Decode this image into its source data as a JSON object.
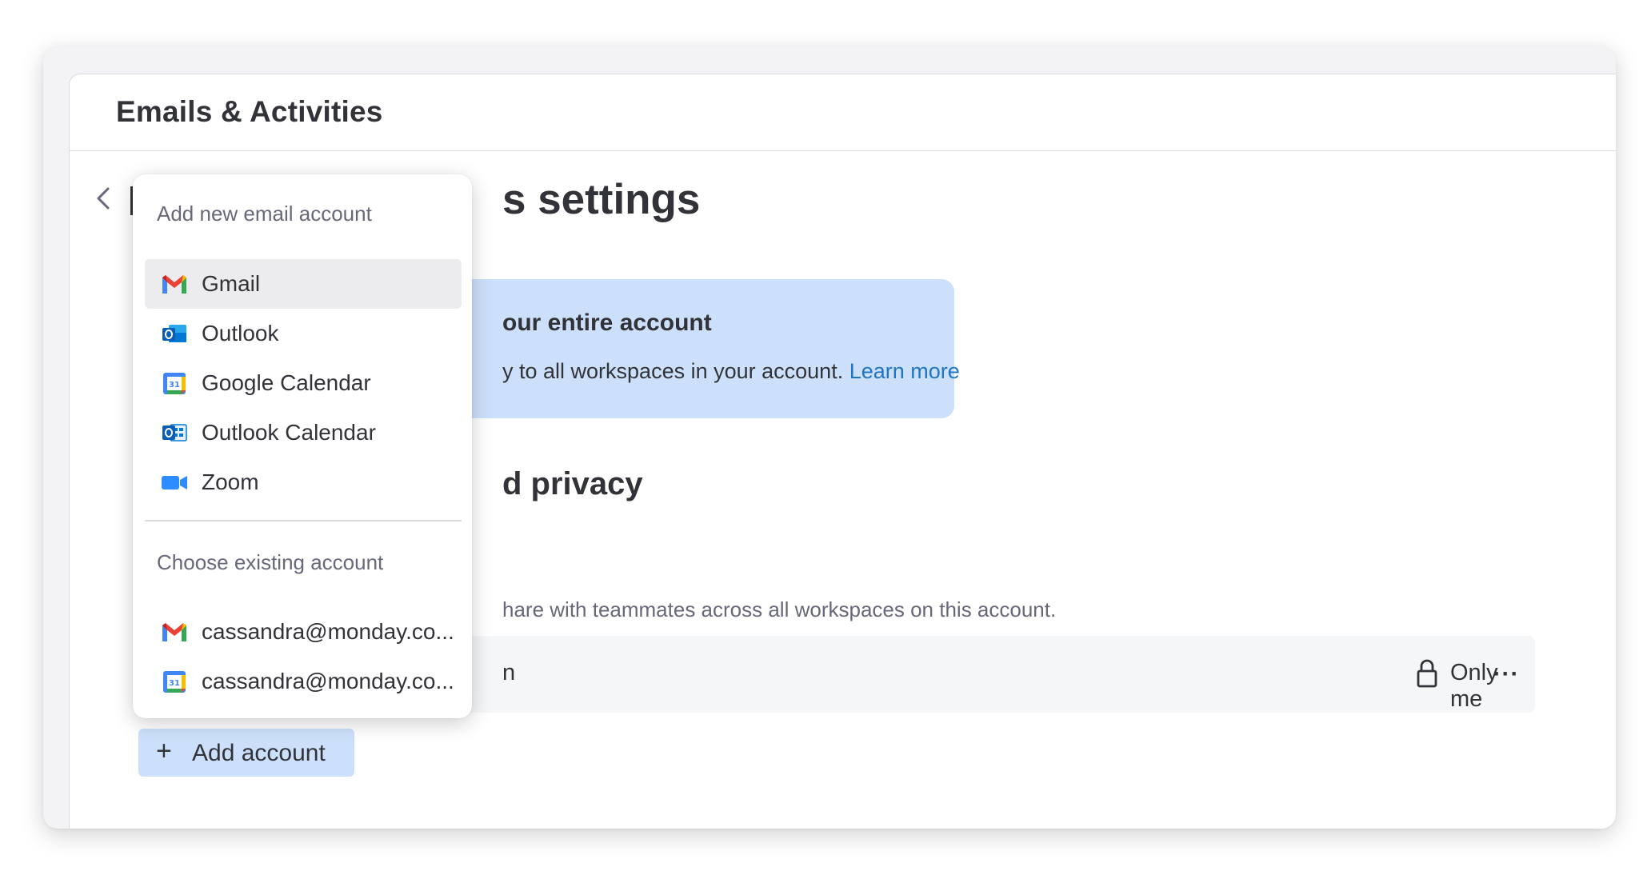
{
  "panel": {
    "title": "Emails & Activities"
  },
  "page": {
    "title_visible": "s settings"
  },
  "info_box": {
    "title_visible": "our entire account",
    "text_visible": "y to all workspaces in your account.",
    "link": "Learn more",
    "color": "#cce0fb"
  },
  "section": {
    "title_visible": "d privacy",
    "description_visible": "hare with teammates across all workspaces on this account."
  },
  "account_row": {
    "name_visible": "n",
    "privacy": "Only me",
    "more": "···"
  },
  "add_account": {
    "plus": "+",
    "label": "Add account"
  },
  "dropdown": {
    "new_heading": "Add new email account",
    "new_items": [
      {
        "label": "Gmail",
        "icon": "gmail-icon"
      },
      {
        "label": "Outlook",
        "icon": "outlook-icon"
      },
      {
        "label": "Google Calendar",
        "icon": "google-calendar-icon"
      },
      {
        "label": "Outlook Calendar",
        "icon": "outlook-calendar-icon"
      },
      {
        "label": "Zoom",
        "icon": "zoom-icon"
      }
    ],
    "existing_heading": "Choose existing account",
    "existing_items": [
      {
        "label": "cassandra@monday.co...",
        "icon": "gmail-icon"
      },
      {
        "label": "cassandra@monday.co...",
        "icon": "google-calendar-icon"
      }
    ]
  },
  "colors": {
    "accent": "#1f76c2",
    "text": "#323338",
    "muted": "#676879"
  }
}
